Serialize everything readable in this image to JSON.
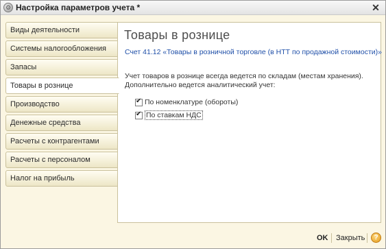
{
  "window": {
    "title": "Настройка параметров учета *"
  },
  "sidebar": {
    "items": [
      {
        "label": "Виды деятельности"
      },
      {
        "label": "Системы налогообложения"
      },
      {
        "label": "Запасы"
      },
      {
        "label": "Товары в рознице",
        "active": true
      },
      {
        "label": "Производство"
      },
      {
        "label": "Денежные средства"
      },
      {
        "label": "Расчеты с контрагентами"
      },
      {
        "label": "Расчеты с персоналом"
      },
      {
        "label": "Налог на прибыль"
      }
    ]
  },
  "main": {
    "title": "Товары в рознице",
    "account_link": "Счет 41.12 «Товары в розничной торговле (в НТТ по продажной стоимости)»",
    "description_line1": "Учет товаров в рознице всегда ведется по складам (местам хранения).",
    "description_line2": "Дополнительно ведется аналитический учет:",
    "checks": [
      {
        "label": "По номенклатуре (обороты)",
        "checked": true
      },
      {
        "label": "По ставкам НДС",
        "checked": true
      }
    ]
  },
  "footer": {
    "ok_label": "OK",
    "close_label": "Закрыть",
    "help_label": "?"
  },
  "colors": {
    "background": "#fbf6e3",
    "link": "#1f4fa8",
    "help": "#e39b1e"
  },
  "icons": {
    "title": "settings-gear-icon",
    "close": "close-icon",
    "help": "help-icon"
  }
}
